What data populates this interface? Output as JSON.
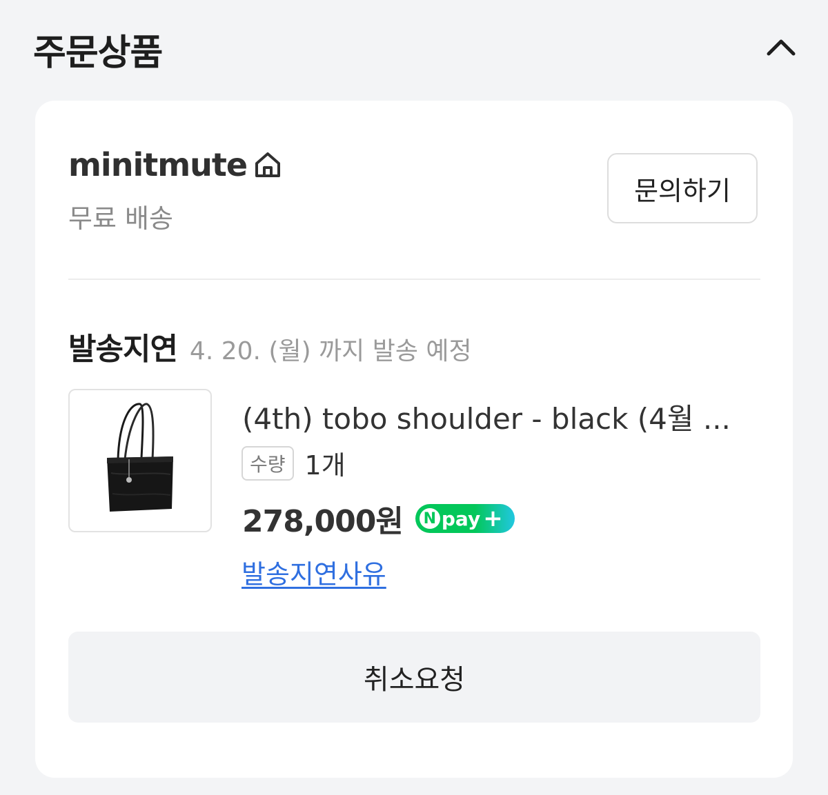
{
  "header": {
    "title": "주문상품",
    "collapse_icon": "chevron-up-icon"
  },
  "seller": {
    "name": "minitmute",
    "home_icon": "home-icon",
    "shipping_fee": "무료 배송",
    "inquiry_label": "문의하기"
  },
  "delivery": {
    "status": "발송지연",
    "expected": "4. 20. (월) 까지 발송 예정"
  },
  "product": {
    "name": "(4th) tobo shoulder - black (4월 ...",
    "qty_label": "수량",
    "qty_value": "1개",
    "price": "278,000원",
    "npay_badge": {
      "n": "N",
      "text": "pay",
      "plus": "+"
    },
    "delay_reason_link": "발송지연사유"
  },
  "actions": {
    "cancel_label": "취소요청"
  },
  "colors": {
    "background": "#f3f4f6",
    "card": "#ffffff",
    "link": "#2f6fe0",
    "npay_green": "#03c75a"
  }
}
